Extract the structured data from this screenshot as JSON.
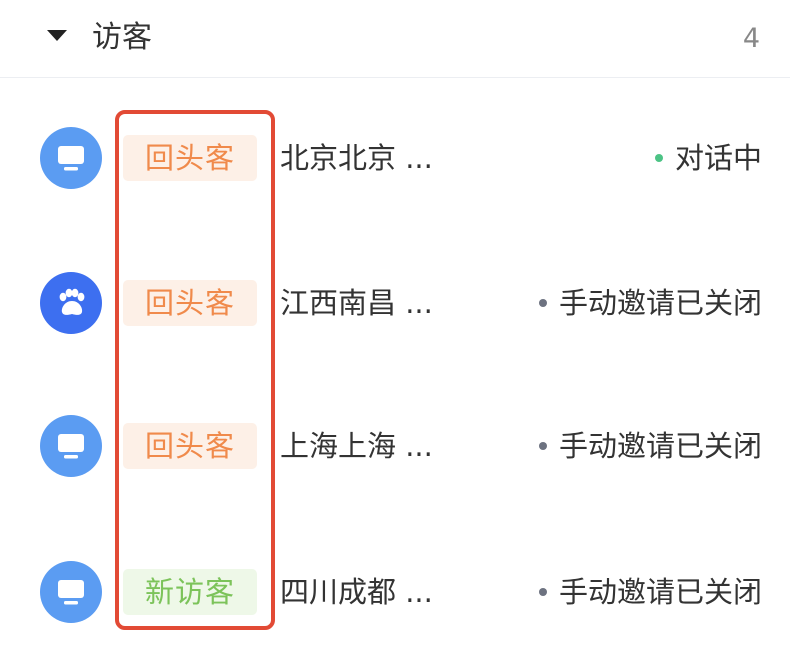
{
  "header": {
    "title": "访客",
    "count": "4"
  },
  "visitors": [
    {
      "avatar_icon": "monitor-icon",
      "avatar_color": "#5b9cf2",
      "tag": "回头客",
      "tag_color": "#f08a4b",
      "tag_bg": "#fdf0e7",
      "location": "北京北京 ...",
      "status": "对话中",
      "status_dot_color": "#4cc385"
    },
    {
      "avatar_icon": "paw-icon",
      "avatar_color": "#3d6ff0",
      "tag": "回头客",
      "tag_color": "#f08a4b",
      "tag_bg": "#fdf0e7",
      "location": "江西南昌 ...",
      "status": "手动邀请已关闭",
      "status_dot_color": "#6d7280"
    },
    {
      "avatar_icon": "monitor-icon",
      "avatar_color": "#5b9cf2",
      "tag": "回头客",
      "tag_color": "#f08a4b",
      "tag_bg": "#fdf0e7",
      "location": "上海上海 ...",
      "status": "手动邀请已关闭",
      "status_dot_color": "#6d7280"
    },
    {
      "avatar_icon": "monitor-icon",
      "avatar_color": "#5b9cf2",
      "tag": "新访客",
      "tag_color": "#7cc35a",
      "tag_bg": "#eef8e8",
      "location": "四川成都 ...",
      "status": "手动邀请已关闭",
      "status_dot_color": "#6d7280"
    }
  ],
  "highlight_color": "#e24a35"
}
